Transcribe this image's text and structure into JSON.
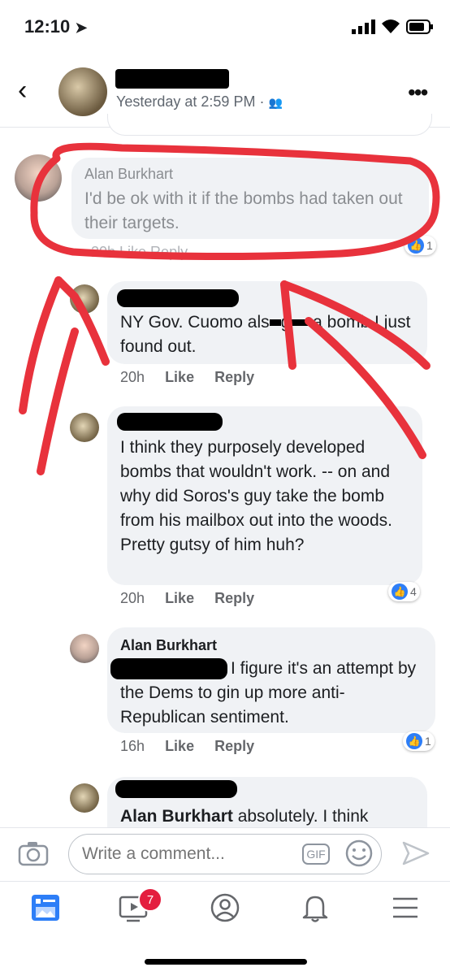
{
  "status_bar": {
    "time": "12:10"
  },
  "post_header": {
    "timestamp": "Yesterday at 2:59 PM · "
  },
  "comments": [
    {
      "name": "Alan Burkhart",
      "text": "I'd be ok with it if the bombs had taken out their targets.",
      "reactions": "1",
      "actions": "20h  Like  Reply"
    },
    {
      "text_before": "NY Gov. Cuomo als",
      "text_mid": "g",
      "text_after": "a bomb I just found out.",
      "time": "20h",
      "like": "Like",
      "reply": "Reply"
    },
    {
      "text": "I think they purposely developed bombs that wouldn't work.  -- on and why did Soros's guy take the bomb from his mailbox out into the woods.  Pretty gutsy of him huh?",
      "time": "20h",
      "like": "Like",
      "reply": "Reply",
      "reactions": "4"
    },
    {
      "name": "Alan Burkhart",
      "text": "I figure it's an attempt by the Dems to gin up more anti-Republican sentiment.",
      "time": "16h",
      "like": "Like",
      "reply": "Reply",
      "reactions": "1"
    },
    {
      "mention": "Alan Burkhart",
      "text": " absolutely. I think"
    }
  ],
  "composer": {
    "placeholder": "Write a comment...",
    "gif_label": "GIF"
  },
  "tab_bar": {
    "watch_badge": "7"
  },
  "colors": {
    "accent": "#2d7ef7",
    "annotation": "#e8323c",
    "badge": "#e41e3f"
  }
}
